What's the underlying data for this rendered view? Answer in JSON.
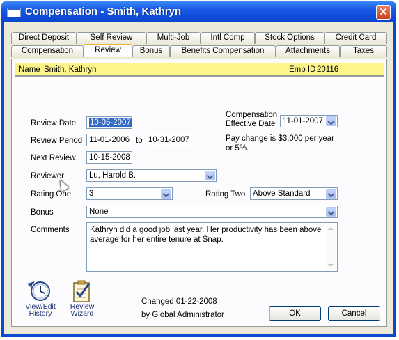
{
  "window": {
    "title": "Compensation - Smith, Kathryn",
    "close_glyph": "✕"
  },
  "tabs_row1": [
    {
      "label": "Direct Deposit"
    },
    {
      "label": "Self Review"
    },
    {
      "label": "Multi-Job"
    },
    {
      "label": "Intl Comp"
    },
    {
      "label": "Stock Options"
    },
    {
      "label": "Credit Card"
    }
  ],
  "tabs_row2": [
    {
      "label": "Compensation"
    },
    {
      "label": "Review"
    },
    {
      "label": "Bonus"
    },
    {
      "label": "Benefits Compensation"
    },
    {
      "label": "Attachments"
    },
    {
      "label": "Taxes"
    }
  ],
  "active_tab": "Review",
  "header": {
    "name_label": "Name",
    "name_value": "Smith, Kathryn",
    "emp_label": "Emp ID",
    "emp_value": "20116"
  },
  "form": {
    "review_date_label": "Review Date",
    "review_date": "10-05-2007",
    "review_period_label": "Review Period",
    "review_period_start": "11-01-2006",
    "to_label": "to",
    "review_period_end": "10-31-2007",
    "next_review_label": "Next Review",
    "next_review": "10-15-2008",
    "reviewer_label": "Reviewer",
    "reviewer": "Lu, Harold B.",
    "rating_one_label": "Rating One",
    "rating_one": "3",
    "rating_two_label": "Rating Two",
    "rating_two": "Above Standard",
    "bonus_label": "Bonus",
    "bonus": "None",
    "comments_label": "Comments",
    "comments": "Kathryn did a good job last year. Her productivity has been above average for her entire tenure at Snap.",
    "comp_eff_label_1": "Compensation",
    "comp_eff_label_2": "Effective Date",
    "comp_eff_date": "11-01-2007",
    "pay_change_1": "Pay change is $3,000 per year",
    "pay_change_2": "or 5%."
  },
  "footer": {
    "history_label_1": "View/Edit",
    "history_label_2": "History",
    "wizard_label_1": "Review",
    "wizard_label_2": "Wizard",
    "changed_text": "Changed 01-22-2008",
    "changed_by": "by Global Administrator",
    "ok_label": "OK",
    "cancel_label": "Cancel"
  },
  "colors": {
    "titlebar": "#0a4ad0",
    "namebar": "#fdf48a",
    "selection": "#316ac5"
  },
  "icons": [
    "window-icon",
    "close-icon",
    "clock-history-icon",
    "checklist-wizard-icon",
    "dropdown-arrow-icon",
    "mouse-cursor-icon"
  ]
}
